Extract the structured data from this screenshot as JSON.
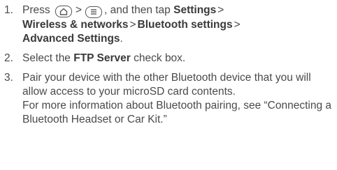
{
  "steps": [
    {
      "num": "1.",
      "press": "Press",
      "gt": ">",
      "and_tap": ", and then tap",
      "path": [
        "Settings",
        "Wireless & networks",
        "Bluetooth settings",
        "Advanced Settings"
      ],
      "end": ".",
      "icons": [
        "home-icon",
        "menu-icon"
      ]
    },
    {
      "num": "2.",
      "pre": "Select the",
      "bold": "FTP Server",
      "post": "check box."
    },
    {
      "num": "3.",
      "line": "Pair your device with the other Bluetooth device that you will allow access to your microSD card contents.",
      "more": "For more information about Bluetooth pairing, see “Connecting a Bluetooth Headset or Car Kit.”"
    }
  ]
}
